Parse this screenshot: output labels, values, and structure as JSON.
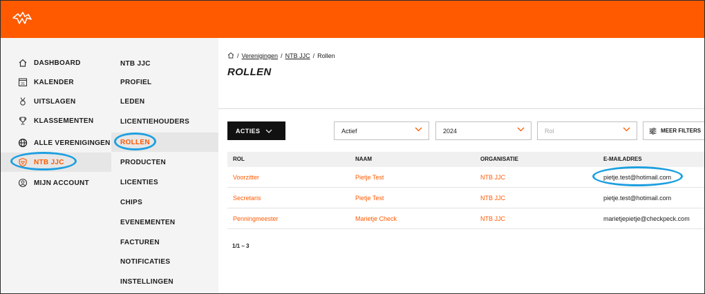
{
  "brand": {
    "accent": "#ff5a00",
    "highlight": "#1e9fe0"
  },
  "sidebar": {
    "items": [
      {
        "label": "DASHBOARD",
        "icon": "home-icon"
      },
      {
        "label": "KALENDER",
        "icon": "calendar-icon",
        "icon_text": "31"
      },
      {
        "label": "UITSLAGEN",
        "icon": "medal-icon"
      },
      {
        "label": "KLASSEMENTEN",
        "icon": "trophy-icon"
      },
      {
        "label": "ALLE VERENIGINGEN",
        "icon": "globe-icon"
      },
      {
        "label": "NTB JJC",
        "icon": "shield-icon",
        "active": true
      },
      {
        "label": "MIJN ACCOUNT",
        "icon": "user-icon"
      }
    ]
  },
  "subnav": {
    "items": [
      {
        "label": "NTB JJC"
      },
      {
        "label": "PROFIEL"
      },
      {
        "label": "LEDEN"
      },
      {
        "label": "LICENTIEHOUDERS"
      },
      {
        "label": "ROLLEN",
        "active": true
      },
      {
        "label": "PRODUCTEN"
      },
      {
        "label": "LICENTIES"
      },
      {
        "label": "CHIPS"
      },
      {
        "label": "EVENEMENTEN"
      },
      {
        "label": "FACTUREN"
      },
      {
        "label": "NOTIFICATIES"
      },
      {
        "label": "INSTELLINGEN"
      }
    ]
  },
  "breadcrumb": {
    "sep": "/",
    "items": [
      "Verenigingen",
      "NTB JJC"
    ],
    "current": "Rollen"
  },
  "page": {
    "title": "ROLLEN"
  },
  "toolbar": {
    "actions_label": "ACTIES",
    "filters": [
      {
        "value": "Actief"
      },
      {
        "value": "2024"
      },
      {
        "placeholder": "Rol"
      }
    ],
    "more_filters_label": "MEER FILTERS"
  },
  "table": {
    "columns": [
      "ROL",
      "NAAM",
      "ORGANISATIE",
      "E-MAILADRES"
    ],
    "rows": [
      {
        "rol": "Voorzitter",
        "naam": "Pietje Test",
        "organisatie": "NTB JJC",
        "email": "pietje.test@hotimail.com"
      },
      {
        "rol": "Secretaris",
        "naam": "Pietje Test",
        "organisatie": "NTB JJC",
        "email": "pietje.test@hotimail.com"
      },
      {
        "rol": "Penningmeester",
        "naam": "Marietje Check",
        "organisatie": "NTB JJC",
        "email": "marietjepietje@checkpeck.com"
      }
    ]
  },
  "pagination": {
    "label": "1/1 – 3"
  }
}
